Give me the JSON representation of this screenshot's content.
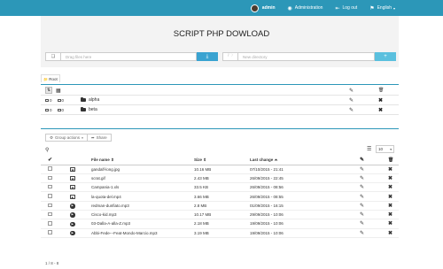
{
  "navbar": {
    "user": "admin",
    "administration": "Administration",
    "logout": "Log out",
    "language": "English"
  },
  "title": "SCRIPT PHP DOWLOAD",
  "upload": {
    "drag_placeholder": "Drag files here",
    "directory_placeholder": "New directory"
  },
  "root_tab": "Root",
  "folders": [
    {
      "name": "alpha",
      "files": "0",
      "dirs": "0"
    },
    {
      "name": "beta",
      "files": "0",
      "dirs": "0"
    }
  ],
  "toolbar": {
    "group_actions": "Group actions",
    "share": "Share",
    "per_page": "10"
  },
  "table": {
    "headers": {
      "name": "File name ⇕",
      "size": "Size ⇕",
      "last_change": "Last change ⏶"
    },
    "rows": [
      {
        "type": "image",
        "name": "gandalf-long.jpg",
        "size": "10.16 MB",
        "date": "07/10/2015 - 21:41"
      },
      {
        "type": "image",
        "name": "scrat.gif",
        "size": "2.43 MB",
        "date": "26/09/2015 - 22:45"
      },
      {
        "type": "sheet",
        "name": "Campania-1.xls",
        "size": "33.5 KB",
        "date": "26/09/2015 - 08:56"
      },
      {
        "type": "video",
        "name": "la-quota-del.mp4",
        "size": "3.66 MB",
        "date": "26/09/2015 - 08:55"
      },
      {
        "type": "audio",
        "name": "redman-dunfiato.mp3",
        "size": "2.8 MB",
        "date": "01/09/2015 - 16:15"
      },
      {
        "type": "audio",
        "name": "Cisco-kid.mp3",
        "size": "10.17 MB",
        "date": "29/09/2015 - 10:06"
      },
      {
        "type": "audio",
        "name": "03-Dalla-A-alla-Z.mp3",
        "size": "2.18 MB",
        "date": "19/09/2015 - 10:06"
      },
      {
        "type": "audio",
        "name": "Abbi-Fede---Feat-Mondo-Marcio.mp3",
        "size": "3.19 MB",
        "date": "19/09/2015 - 10:06"
      }
    ]
  },
  "pager": "1 / 8 - 8",
  "colors": {
    "accent": "#2c97b8",
    "upload_button": "#3aa3d1",
    "create_button": "#5bc0de"
  }
}
